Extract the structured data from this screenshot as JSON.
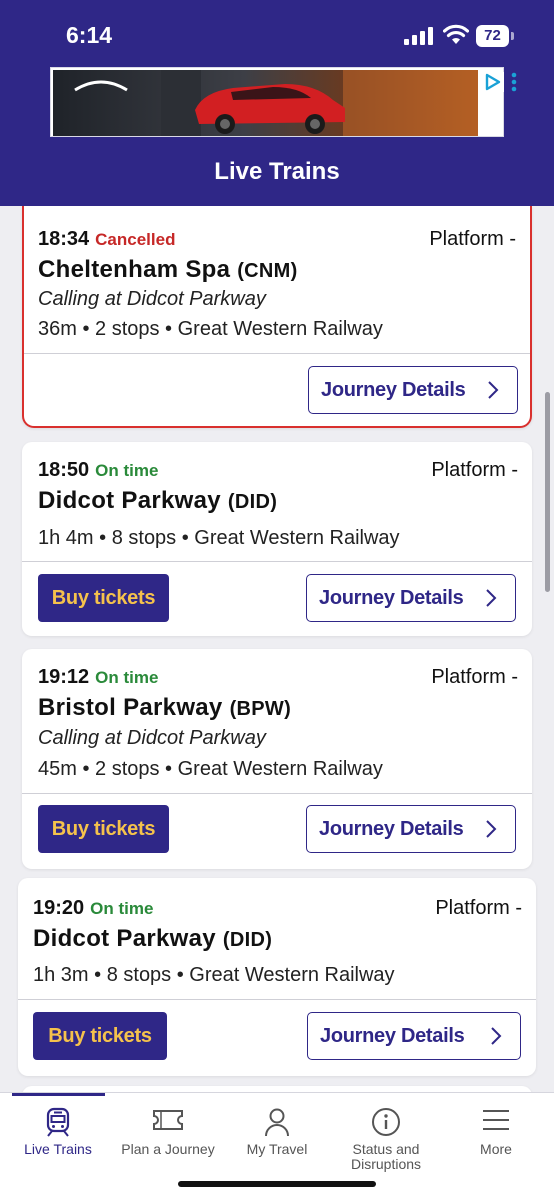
{
  "status_bar": {
    "time": "6:14",
    "battery": "72"
  },
  "header": {
    "title": "Live Trains"
  },
  "colors": {
    "brand": "#2f2787",
    "button_text": "#f5c24c",
    "cancelled": "#c62827",
    "on_time": "#2a8a3a"
  },
  "trains": [
    {
      "time": "18:34",
      "status": "Cancelled",
      "platform": "Platform -",
      "station": "Cheltenham Spa",
      "code": "(CNM)",
      "calling": "Calling at Didcot Parkway",
      "meta": "36m • 2 stops • Great Western Railway",
      "journey_label": "Journey Details"
    },
    {
      "time": "18:50",
      "status": "On time",
      "platform": "Platform -",
      "station": "Didcot Parkway",
      "code": "(DID)",
      "meta": "1h 4m • 8 stops • Great Western Railway",
      "buy_label": "Buy tickets",
      "journey_label": "Journey Details"
    },
    {
      "time": "19:12",
      "status": "On time",
      "platform": "Platform -",
      "station": "Bristol Parkway",
      "code": "(BPW)",
      "calling": "Calling at Didcot Parkway",
      "meta": "45m • 2 stops • Great Western Railway",
      "buy_label": "Buy tickets",
      "journey_label": "Journey Details"
    },
    {
      "time": "19:20",
      "status": "On time",
      "platform": "Platform -",
      "station": "Didcot Parkway",
      "code": "(DID)",
      "meta": "1h 3m • 8 stops • Great Western Railway",
      "buy_label": "Buy tickets",
      "journey_label": "Journey Details"
    }
  ],
  "nav": [
    {
      "label": "Live Trains",
      "icon": "train-icon",
      "active": true
    },
    {
      "label": "Plan a Journey",
      "icon": "ticket-icon"
    },
    {
      "label": "My Travel",
      "icon": "person-icon"
    },
    {
      "label": "Status and Disruptions",
      "icon": "info-icon"
    },
    {
      "label": "More",
      "icon": "menu-icon"
    }
  ]
}
